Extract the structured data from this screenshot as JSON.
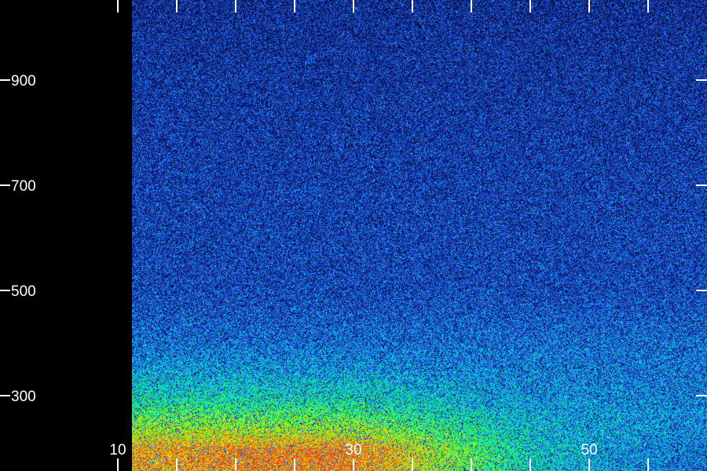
{
  "chart_data": {
    "type": "heatmap",
    "title": "",
    "xlabel": "",
    "ylabel": "",
    "x_ticks": [
      {
        "value": 10,
        "label": "10"
      },
      {
        "value": 15,
        "label": ""
      },
      {
        "value": 20,
        "label": ""
      },
      {
        "value": 25,
        "label": ""
      },
      {
        "value": 30,
        "label": "30"
      },
      {
        "value": 35,
        "label": ""
      },
      {
        "value": 40,
        "label": ""
      },
      {
        "value": 45,
        "label": ""
      },
      {
        "value": 50,
        "label": "50"
      },
      {
        "value": 55,
        "label": ""
      }
    ],
    "y_ticks": [
      {
        "value": 300,
        "label": "300"
      },
      {
        "value": 500,
        "label": "500"
      },
      {
        "value": 700,
        "label": "700"
      },
      {
        "value": 900,
        "label": "900"
      }
    ],
    "xlim": [
      10,
      58.5
    ],
    "ylim": [
      160,
      1050
    ],
    "intensity_range": [
      0,
      1
    ],
    "colormap": [
      "#000000",
      "#0a1a78",
      "#1e3cc8",
      "#1ea0ff",
      "#00e6c8",
      "#32ff32",
      "#dcf000",
      "#ffaa00",
      "#ff3200"
    ],
    "grid": false,
    "legend": "none",
    "intensity_profile": {
      "description_units": "relative intensity 0-1 by y (data units) at x=30",
      "y": [
        200,
        250,
        300,
        350,
        400,
        500,
        700,
        900,
        1050
      ],
      "intensity": [
        0.82,
        0.66,
        0.5,
        0.4,
        0.33,
        0.26,
        0.24,
        0.22,
        0.2
      ]
    },
    "hotspot": {
      "x_center": 28,
      "x_width": 16,
      "y_peak": 180
    },
    "x_falloff": {
      "x": [
        10,
        30,
        38,
        45,
        55,
        58.5
      ],
      "factor": [
        1.0,
        0.98,
        0.75,
        0.55,
        0.45,
        0.42
      ]
    }
  }
}
